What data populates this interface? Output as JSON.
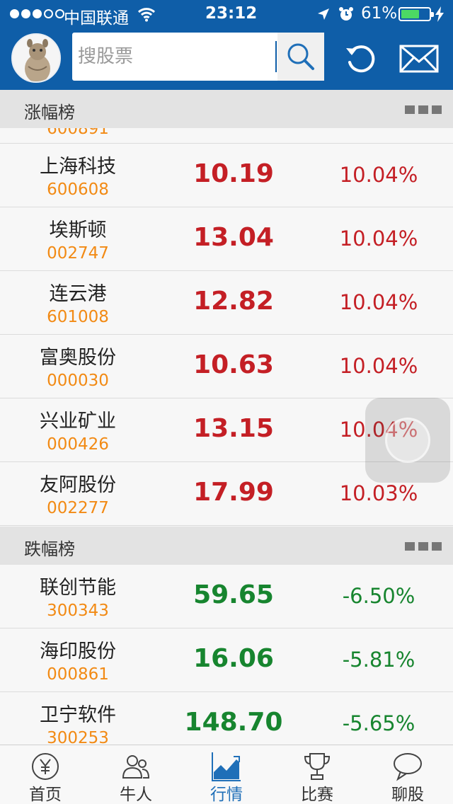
{
  "status_bar": {
    "carrier": "中国联通",
    "time": "23:12",
    "battery_percent": "61%",
    "battery_level": 0.61
  },
  "header": {
    "search_placeholder": "搜股票",
    "icons": [
      "avatar",
      "search-icon",
      "refresh-icon",
      "mail-icon"
    ],
    "colors": {
      "bar": "#0f5ea8"
    }
  },
  "gainers": {
    "title": "涨幅榜",
    "partial_code": "600891",
    "rows": [
      {
        "name": "上海科技",
        "code": "600608",
        "price": "10.19",
        "change": "10.04%"
      },
      {
        "name": "埃斯顿",
        "code": "002747",
        "price": "13.04",
        "change": "10.04%"
      },
      {
        "name": "连云港",
        "code": "601008",
        "price": "12.82",
        "change": "10.04%"
      },
      {
        "name": "富奥股份",
        "code": "000030",
        "price": "10.63",
        "change": "10.04%"
      },
      {
        "name": "兴业矿业",
        "code": "000426",
        "price": "13.15",
        "change": "10.04%"
      },
      {
        "name": "友阿股份",
        "code": "002277",
        "price": "17.99",
        "change": "10.03%"
      }
    ]
  },
  "losers": {
    "title": "跌幅榜",
    "rows": [
      {
        "name": "联创节能",
        "code": "300343",
        "price": "59.65",
        "change": "-6.50%"
      },
      {
        "name": "海印股份",
        "code": "000861",
        "price": "16.06",
        "change": "-5.81%"
      },
      {
        "name": "卫宁软件",
        "code": "300253",
        "price": "148.70",
        "change": "-5.65%"
      }
    ]
  },
  "colors": {
    "up": "#c41f25",
    "down": "#17852f",
    "code": "#f28a14",
    "active_tab": "#1f6fb8"
  },
  "tabs": [
    {
      "label": "首页",
      "icon": "home-yen-icon"
    },
    {
      "label": "牛人",
      "icon": "people-icon"
    },
    {
      "label": "行情",
      "icon": "chart-icon",
      "active": true
    },
    {
      "label": "比赛",
      "icon": "trophy-icon"
    },
    {
      "label": "聊股",
      "icon": "chat-icon"
    }
  ]
}
